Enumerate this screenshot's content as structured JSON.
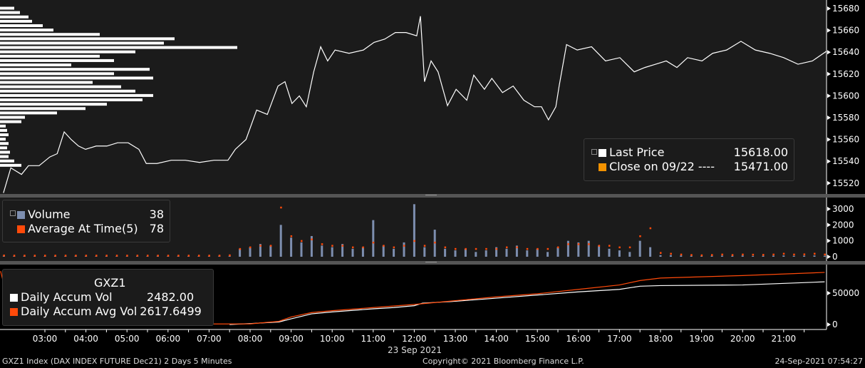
{
  "colors": {
    "price": "#ffffff",
    "profile": "#ffffff",
    "volume": "#7d8eaf",
    "avg": "#ff4a0a",
    "close": "#f39200",
    "accum_vol": "#ffffff",
    "accum_avg": "#ff4a0a"
  },
  "legend_price": {
    "items": [
      {
        "label": "Last Price",
        "value": "15618.00"
      },
      {
        "label": "Close on 09/22 ----",
        "value": "15471.00"
      }
    ]
  },
  "legend_volume": {
    "items": [
      {
        "label": "Volume",
        "value": "38"
      },
      {
        "label": "Average At Time(5)",
        "value": "78"
      }
    ]
  },
  "legend_accum": {
    "title": "GXZ1",
    "items": [
      {
        "label": "Daily Accum Vol",
        "value": "2482.00"
      },
      {
        "label": "Daily Accum Avg Vol",
        "value": "2617.6499"
      }
    ]
  },
  "footer": {
    "left": "GXZ1 Index (DAX INDEX FUTURE  Dec21) 2 Days 5 Minutes",
    "center": "Copyright© 2021 Bloomberg Finance L.P.",
    "right": "24-Sep-2021 07:54:27"
  },
  "chart_data": [
    {
      "type": "line",
      "title": "Last Price",
      "ylim": [
        15510,
        15685
      ],
      "yticks": [
        15520,
        15540,
        15560,
        15580,
        15600,
        15620,
        15640,
        15660,
        15680
      ],
      "x_hours": [
        1.99,
        2.17,
        2.43,
        2.6,
        2.86,
        3.12,
        3.3,
        3.47,
        3.64,
        3.82,
        3.99,
        4.25,
        4.51,
        4.77,
        5.03,
        5.29,
        5.47,
        5.73,
        6.08,
        6.42,
        6.77,
        7.12,
        7.46,
        7.64,
        7.9,
        8.16,
        8.42,
        8.68,
        8.85,
        9.02,
        9.2,
        9.37,
        9.55,
        9.72,
        9.89,
        10.07,
        10.41,
        10.76,
        11.02,
        11.28,
        11.54,
        11.8,
        12.06,
        12.15,
        12.25,
        12.41,
        12.58,
        12.81,
        13.02,
        13.28,
        13.45,
        13.71,
        13.89,
        14.15,
        14.41,
        14.67,
        14.93,
        15.1,
        15.27,
        15.45,
        15.53,
        15.71,
        15.97,
        16.32,
        16.66,
        17.01,
        17.36,
        17.62,
        17.88,
        18.14,
        18.4,
        18.66,
        19.01,
        19.27,
        19.61,
        19.96,
        20.31,
        20.66,
        21.0,
        21.35,
        21.7,
        22.05
      ],
      "values": [
        15511,
        15534,
        15528,
        15536,
        15536,
        15544,
        15547,
        15567,
        15560,
        15554,
        15551,
        15554,
        15554,
        15557,
        15557,
        15551,
        15538,
        15538,
        15541,
        15541,
        15539,
        15541,
        15541,
        15551,
        15560,
        15587,
        15583,
        15609,
        15613,
        15593,
        15600,
        15590,
        15622,
        15645,
        15632,
        15642,
        15639,
        15642,
        15649,
        15652,
        15658,
        15658,
        15655,
        15673,
        15613,
        15632,
        15622,
        15591,
        15606,
        15596,
        15619,
        15606,
        15616,
        15603,
        15609,
        15596,
        15590,
        15590,
        15578,
        15590,
        15609,
        15647,
        15642,
        15645,
        15632,
        15635,
        15622,
        15626,
        15629,
        15632,
        15626,
        15635,
        15632,
        15639,
        15642,
        15650,
        15642,
        15639,
        15635,
        15629,
        15632,
        15641
      ]
    },
    {
      "type": "bar",
      "title": "Volume profile",
      "orientation": "horizontal",
      "price_levels": [
        15536,
        15540,
        15544,
        15548,
        15552,
        15556,
        15560,
        15564,
        15568,
        15572,
        15576,
        15580,
        15584,
        15588,
        15592,
        15596,
        15600,
        15604,
        15608,
        15612,
        15616,
        15620,
        15624,
        15628,
        15632,
        15636,
        15640,
        15644,
        15648,
        15652,
        15656,
        15660,
        15664,
        15668,
        15672,
        15676,
        15680
      ],
      "values": [
        30,
        20,
        12,
        14,
        10,
        12,
        8,
        12,
        10,
        8,
        30,
        35,
        80,
        120,
        150,
        200,
        215,
        190,
        170,
        130,
        215,
        160,
        210,
        100,
        160,
        140,
        190,
        333,
        230,
        245,
        140,
        75,
        60,
        45,
        40,
        28,
        20
      ]
    },
    {
      "type": "bar",
      "title": "Volume",
      "ylim": [
        0,
        3400
      ],
      "yticks": [
        0,
        1000,
        2000,
        3000
      ],
      "x_start_hour": 2.0,
      "step_minutes": 15,
      "volume": [
        60,
        40,
        50,
        30,
        40,
        50,
        40,
        60,
        50,
        40,
        50,
        40,
        30,
        50,
        40,
        60,
        40,
        50,
        40,
        50,
        40,
        60,
        50,
        500,
        600,
        800,
        700,
        2000,
        1200,
        900,
        1300,
        700,
        600,
        800,
        500,
        600,
        2300,
        700,
        500,
        900,
        3300,
        600,
        1700,
        500,
        400,
        500,
        300,
        400,
        600,
        500,
        700,
        400,
        500,
        300,
        600,
        1000,
        900,
        1000,
        700,
        500,
        400,
        300,
        1000,
        600,
        100,
        100,
        80,
        60,
        50,
        60,
        70,
        60,
        80,
        50,
        60,
        70,
        80,
        60,
        70,
        80,
        60
      ],
      "avg": [
        90,
        80,
        80,
        80,
        80,
        80,
        80,
        80,
        80,
        80,
        80,
        80,
        80,
        80,
        80,
        80,
        80,
        80,
        80,
        80,
        80,
        80,
        100,
        500,
        600,
        700,
        700,
        3100,
        1300,
        1000,
        1100,
        800,
        700,
        700,
        600,
        600,
        900,
        700,
        600,
        700,
        1000,
        700,
        900,
        600,
        500,
        500,
        500,
        500,
        500,
        600,
        600,
        500,
        500,
        500,
        600,
        800,
        800,
        800,
        700,
        700,
        600,
        600,
        1300,
        1800,
        250,
        200,
        150,
        120,
        100,
        120,
        150,
        120,
        150,
        140,
        130,
        150,
        200,
        150,
        160,
        200,
        150
      ]
    },
    {
      "type": "line",
      "title": "Daily Accum",
      "ylim": [
        -5000,
        110000
      ],
      "yticks": [
        0,
        50000
      ],
      "series": [
        {
          "name": "Daily Accum Vol",
          "x_hours": [
            7.5,
            8,
            8.7,
            9,
            9.5,
            10,
            11,
            11.5,
            12,
            12.2,
            13,
            14,
            15,
            16,
            17,
            17.5,
            18,
            20,
            22
          ],
          "values": [
            0,
            1500,
            4000,
            9000,
            17000,
            20000,
            25000,
            27000,
            30000,
            34000,
            37000,
            42000,
            47000,
            52000,
            56000,
            61000,
            62000,
            63000,
            68000
          ]
        },
        {
          "name": "Daily Accum Avg Vol",
          "x_hours": [
            1.92,
            2.25,
            8,
            8.7,
            9,
            9.5,
            10,
            11,
            12,
            13,
            14,
            15,
            16,
            17,
            17.5,
            18,
            20,
            22
          ],
          "values": [
            85000,
            0,
            1000,
            5000,
            12000,
            19000,
            22000,
            27000,
            32000,
            38000,
            44000,
            49000,
            56000,
            63000,
            70000,
            74000,
            78000,
            83000
          ]
        }
      ]
    },
    {
      "xticks": [
        "03:00",
        "04:00",
        "05:00",
        "06:00",
        "07:00",
        "08:00",
        "09:00",
        "10:00",
        "11:00",
        "12:00",
        "13:00",
        "14:00",
        "15:00",
        "16:00",
        "17:00",
        "18:00",
        "19:00",
        "20:00",
        "21:00"
      ],
      "xlabel": "23 Sep 2021"
    }
  ]
}
